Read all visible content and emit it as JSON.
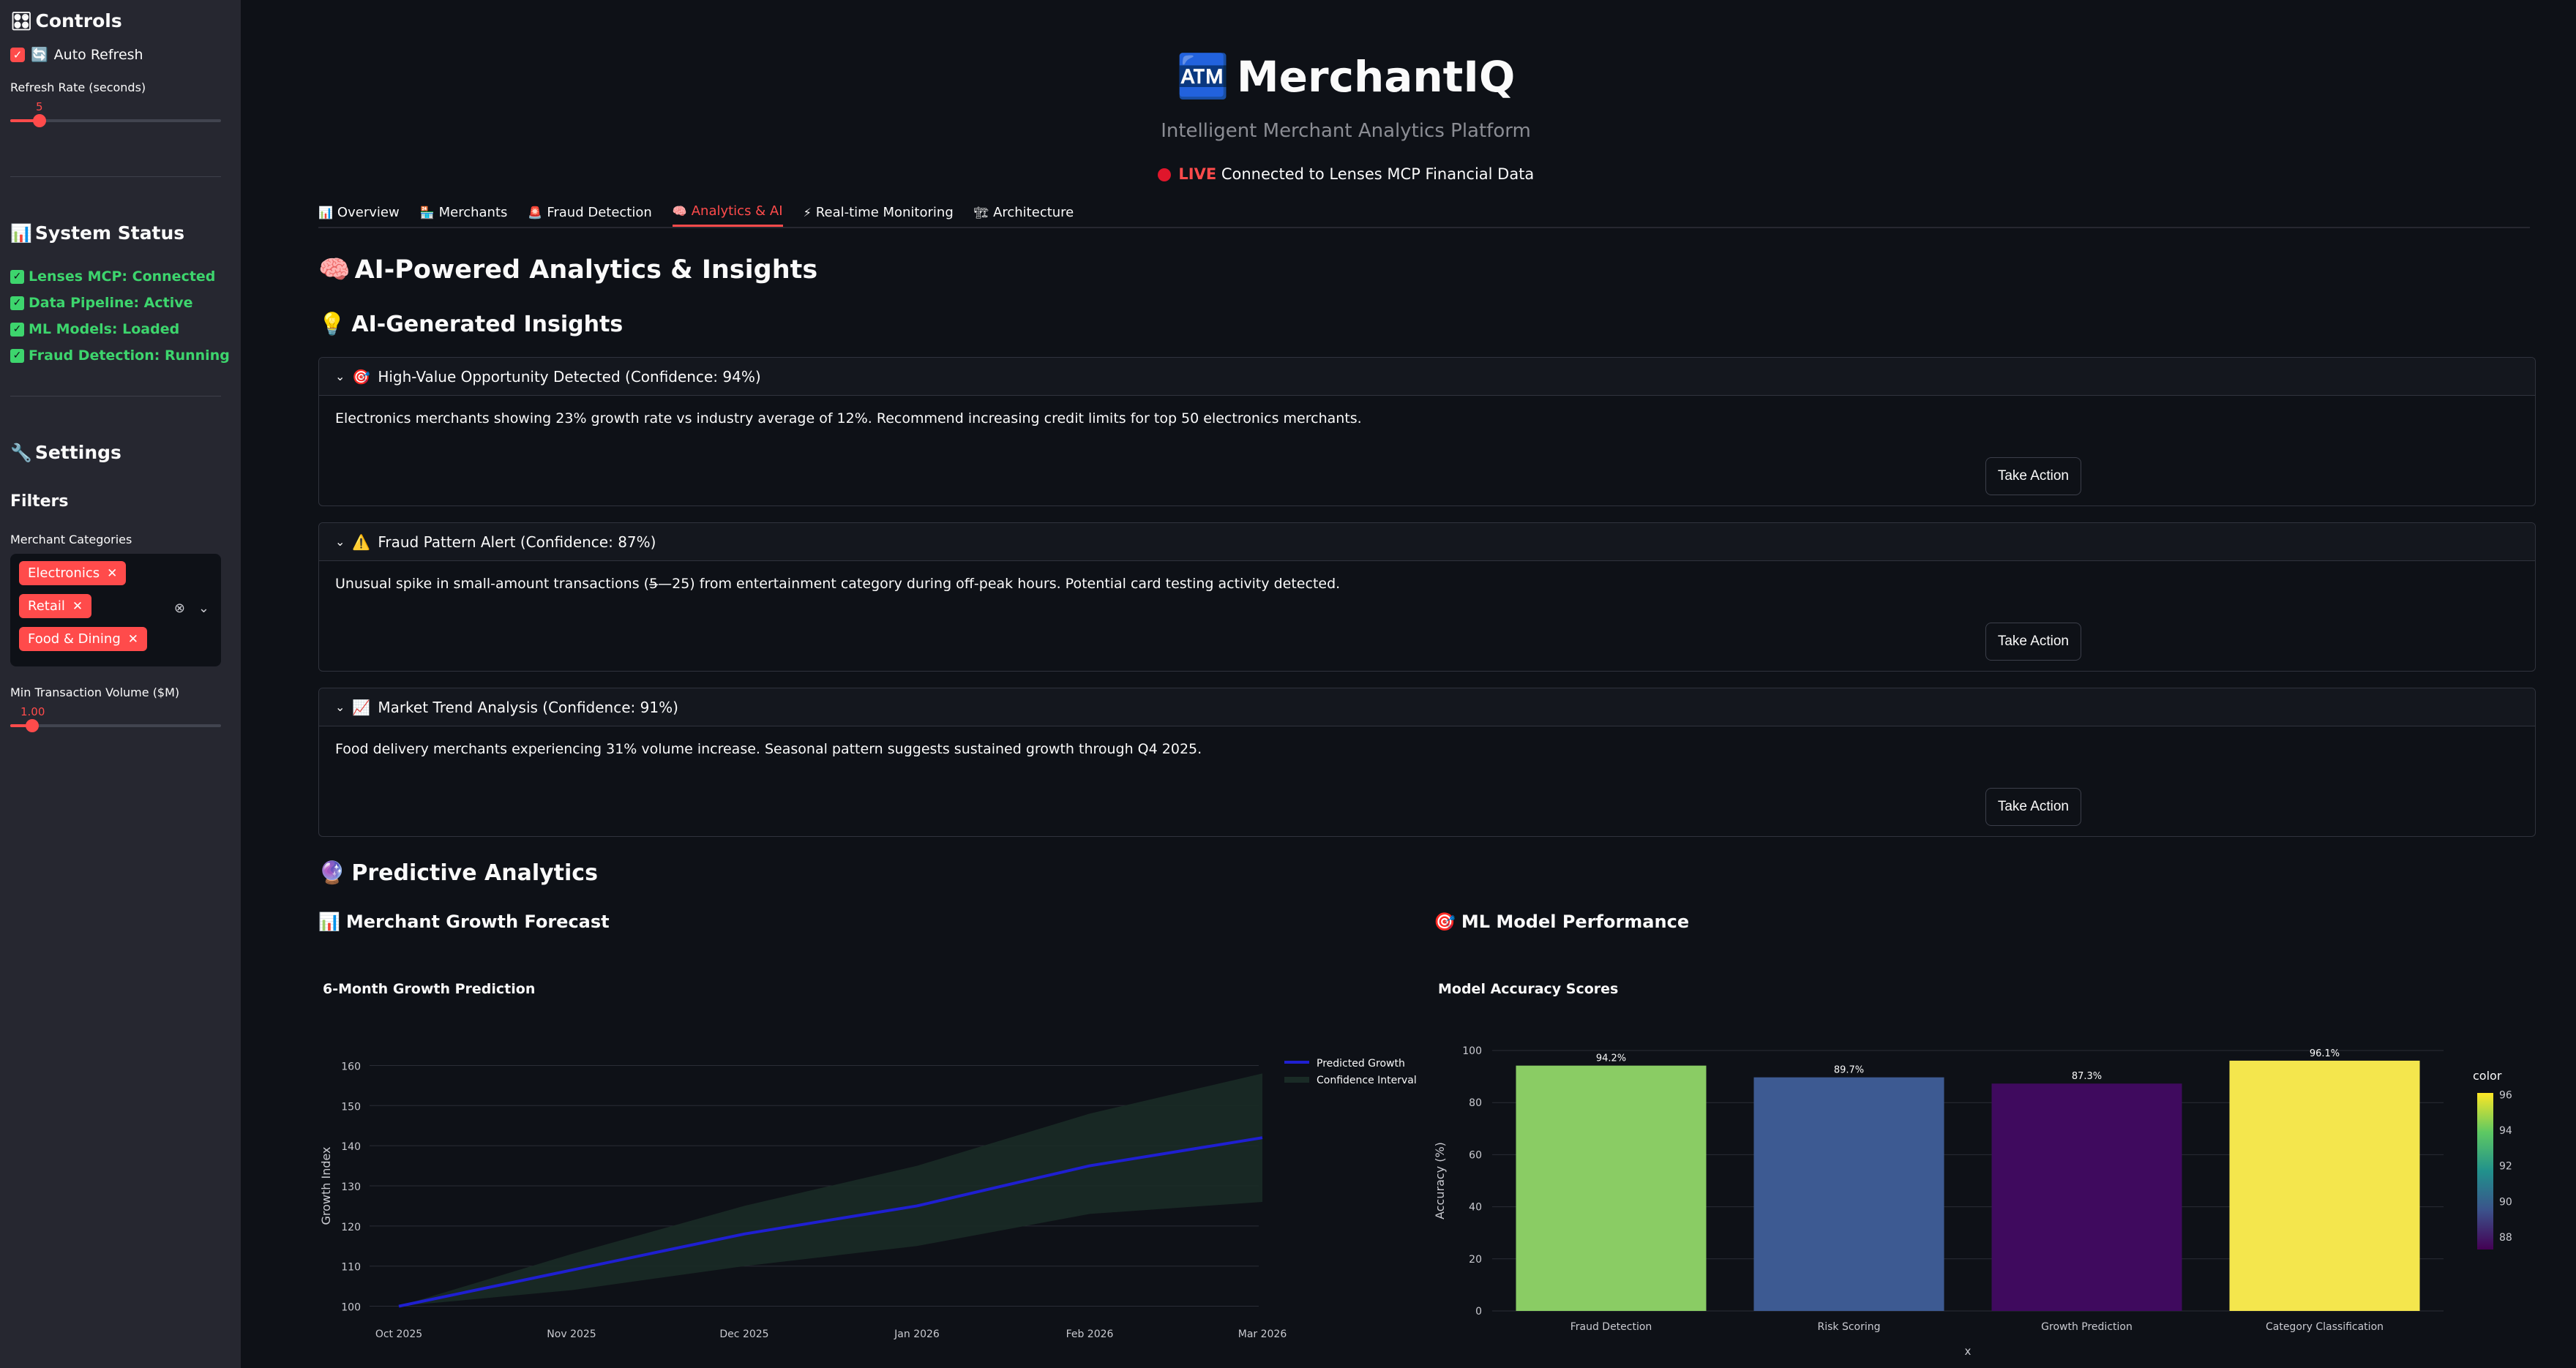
{
  "sidebar": {
    "controls_title": "Controls",
    "auto_refresh_label": "Auto Refresh",
    "auto_refresh_checked": true,
    "refresh_rate_label": "Refresh Rate (seconds)",
    "refresh_rate_value": "5",
    "system_status_title": "System Status",
    "status_items": [
      "Lenses MCP: Connected",
      "Data Pipeline: Active",
      "ML Models: Loaded",
      "Fraud Detection: Running"
    ],
    "settings_title": "Settings",
    "filters_title": "Filters",
    "merchant_categories_label": "Merchant Categories",
    "merchant_categories": [
      "Electronics",
      "Retail",
      "Food & Dining"
    ],
    "min_volume_label": "Min Transaction Volume ($M)",
    "min_volume_value": "1.00"
  },
  "header": {
    "title": "MerchantIQ",
    "subtitle": "Intelligent Merchant Analytics Platform",
    "live_word": "LIVE",
    "live_text": "Connected to Lenses MCP Financial Data"
  },
  "tabs": [
    {
      "label": "Overview",
      "icon": "chart-icon"
    },
    {
      "label": "Merchants",
      "icon": "store-icon"
    },
    {
      "label": "Fraud Detection",
      "icon": "siren-icon"
    },
    {
      "label": "Analytics & AI",
      "icon": "brain-icon",
      "active": true
    },
    {
      "label": "Real-time Monitoring",
      "icon": "bolt-icon"
    },
    {
      "label": "Architecture",
      "icon": "building-icon"
    }
  ],
  "main": {
    "page_heading": "AI-Powered Analytics & Insights",
    "insights_heading": "AI-Generated Insights",
    "insights": [
      {
        "title": "High-Value Opportunity Detected (Confidence: 94%)",
        "icon": "target-icon",
        "body": "Electronics merchants showing 23% growth rate vs industry average of 12%. Recommend increasing credit limits for top 50 electronics merchants.",
        "action": "Take Action"
      },
      {
        "title": "Fraud Pattern Alert (Confidence: 87%)",
        "icon": "warning-icon",
        "body": "Unusual spike in small-amount transactions (5̶—25) from entertainment category during off-peak hours. Potential card testing activity detected.",
        "action": "Take Action"
      },
      {
        "title": "Market Trend Analysis (Confidence: 91%)",
        "icon": "trend-icon",
        "body": "Food delivery merchants experiencing 31% volume increase. Seasonal pattern suggests sustained growth through Q4 2025.",
        "action": "Take Action"
      }
    ],
    "predictive_heading": "Predictive Analytics",
    "forecast_heading": "Merchant Growth Forecast",
    "ml_heading": "ML Model Performance"
  },
  "chart_data": [
    {
      "type": "line",
      "title": "6-Month Growth Prediction",
      "ylabel": "Growth Index",
      "xlabel": "",
      "x": [
        "Oct 2025",
        "Nov 2025",
        "Dec 2025",
        "Jan 2026",
        "Feb 2026",
        "Mar 2026"
      ],
      "series": [
        {
          "name": "Predicted Growth",
          "values": [
            100,
            109,
            118,
            125,
            135,
            142
          ],
          "color": "#1f1fd1"
        },
        {
          "name": "Confidence Interval",
          "upper": [
            100,
            113,
            125,
            135,
            148,
            158
          ],
          "lower": [
            100,
            104,
            110,
            115,
            123,
            126
          ],
          "color": "#1a2b26"
        }
      ],
      "yticks": [
        100,
        110,
        120,
        130,
        140,
        150,
        160
      ],
      "ylim": [
        97,
        163
      ],
      "legend": "top-right",
      "grid": true
    },
    {
      "type": "bar",
      "title": "Model Accuracy Scores",
      "xlabel": "x",
      "ylabel": "Accuracy (%)",
      "categories": [
        "Fraud Detection",
        "Risk Scoring",
        "Growth Prediction",
        "Category Classification"
      ],
      "values": [
        94.2,
        89.7,
        87.3,
        96.1
      ],
      "labels": [
        "94.2%",
        "89.7%",
        "87.3%",
        "96.1%"
      ],
      "colors": [
        "#8acc64",
        "#3d5a92",
        "#3f0a5e",
        "#f4e64d"
      ],
      "yticks": [
        0,
        20,
        40,
        60,
        80,
        100
      ],
      "ylim": [
        0,
        100
      ],
      "colorbar": {
        "title": "color",
        "ticks": [
          88,
          90,
          92,
          94,
          96
        ]
      },
      "grid": true
    }
  ]
}
